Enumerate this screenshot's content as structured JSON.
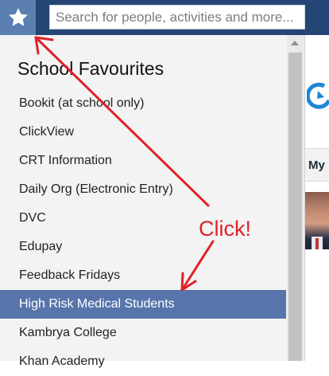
{
  "topbar": {
    "favourites_icon": "star-icon",
    "search": {
      "placeholder": "Search for people, activities and more...",
      "value": ""
    }
  },
  "favourites_panel": {
    "title": "School Favourites",
    "items": [
      {
        "label": "Bookit (at school only)"
      },
      {
        "label": "ClickView"
      },
      {
        "label": "CRT Information"
      },
      {
        "label": "Daily Org (Electronic Entry)"
      },
      {
        "label": "DVC"
      },
      {
        "label": "Edupay"
      },
      {
        "label": "Feedback Fridays"
      },
      {
        "label": "High Risk Medical Students"
      },
      {
        "label": "Kambrya College"
      },
      {
        "label": "Khan Academy"
      }
    ],
    "selected_item": "High Risk Medical Students"
  },
  "background": {
    "tab_label": "My"
  },
  "annotation": {
    "text": "Click!"
  },
  "colors": {
    "topbar": "#254574",
    "star_button": "#5b7fb0",
    "panel_bg": "#f3f3f3",
    "selected_row": "#5875ab",
    "annotation_red": "#e02128",
    "logo_blue": "#1f86d6"
  }
}
